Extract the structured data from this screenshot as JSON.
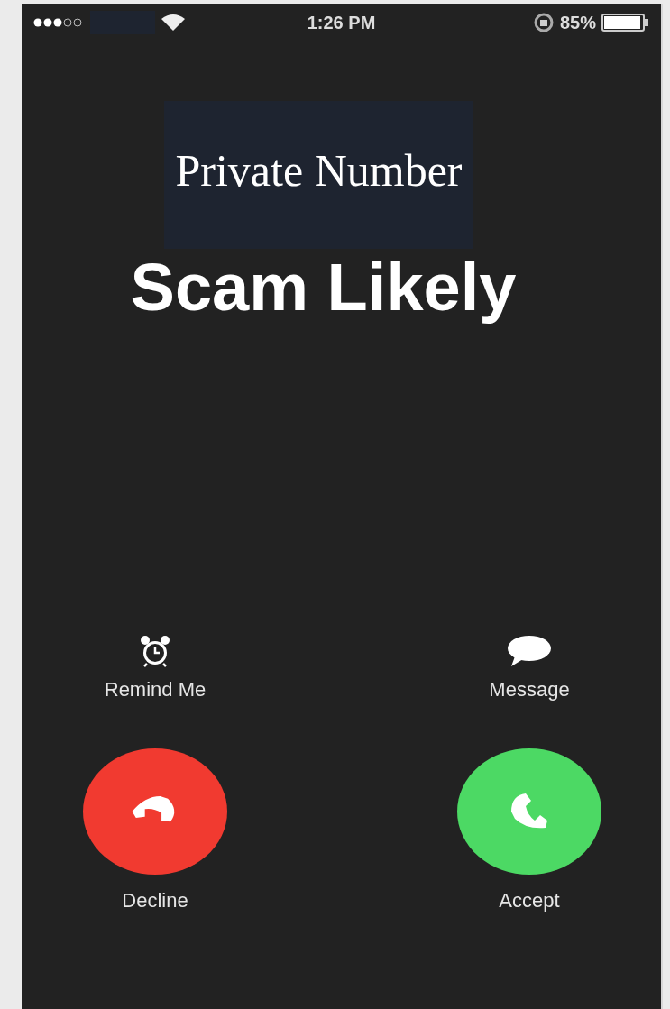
{
  "status_bar": {
    "time": "1:26 PM",
    "battery_text": "85%"
  },
  "caller": {
    "label": "Private Number",
    "name": "Scam Likely"
  },
  "actions": [
    {
      "label": "Remind Me",
      "kind": "remind"
    },
    {
      "label": "Message",
      "kind": "message"
    }
  ],
  "call_buttons": [
    {
      "label": "Decline",
      "kind": "decline"
    },
    {
      "label": "Accept",
      "kind": "accept"
    }
  ]
}
